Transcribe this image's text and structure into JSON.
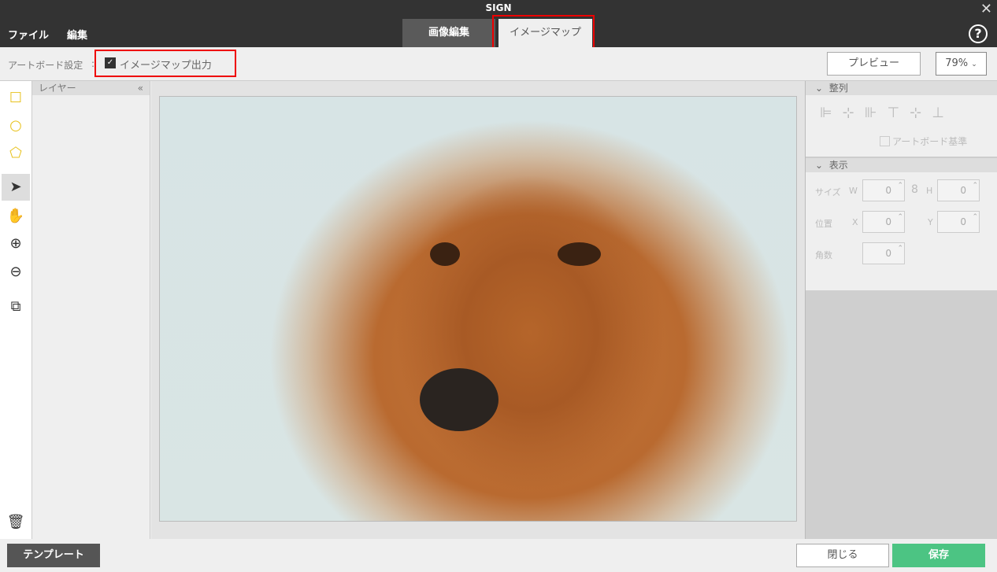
{
  "app": {
    "title": "SIGN"
  },
  "menu": {
    "file": "ファイル",
    "edit": "編集"
  },
  "tabs": {
    "image_edit": "画像編集",
    "image_map": "イメージマップ"
  },
  "toolbar": {
    "artboard_settings": "アートボード設定",
    "separator": ":",
    "imagemap_output": "イメージマップ出力",
    "imagemap_output_checked": true,
    "preview": "プレビュー",
    "zoom": "79%"
  },
  "layers": {
    "title": "レイヤー",
    "collapse": "«"
  },
  "align": {
    "title": "整列",
    "artboard_base": "アートボード基準"
  },
  "display": {
    "title": "表示",
    "size": "サイズ",
    "w": "W",
    "h": "H",
    "position": "位置",
    "x": "X",
    "y": "Y",
    "angle": "角数",
    "w_val": "0",
    "h_val": "0",
    "x_val": "0",
    "y_val": "0",
    "angle_val": "0"
  },
  "footer": {
    "template": "テンプレート",
    "close": "閉じる",
    "save": "保存"
  },
  "colors": {
    "accent": "#4cc483",
    "tool_yellow": "#e8c21e",
    "highlight": "#e00000"
  }
}
